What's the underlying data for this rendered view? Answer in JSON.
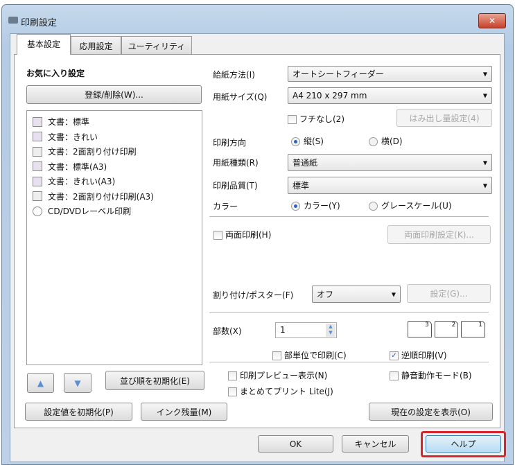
{
  "window": {
    "title": "印刷設定",
    "close_label": "✕"
  },
  "tabs": [
    {
      "label": "基本設定",
      "active": true
    },
    {
      "label": "応用設定"
    },
    {
      "label": "ユーティリティー"
    }
  ],
  "favorites": {
    "heading": "お気に入り設定",
    "register_button": "登録/削除(W)...",
    "items": [
      {
        "label": "文書：標準",
        "icon": "document-icon"
      },
      {
        "label": "文書：きれい",
        "icon": "document-fine-icon"
      },
      {
        "label": "文書：2面割り付け印刷",
        "icon": "layout-2up-icon"
      },
      {
        "label": "文書：標準(A3)",
        "icon": "document-icon"
      },
      {
        "label": "文書：きれい(A3)",
        "icon": "document-fine-icon"
      },
      {
        "label": "文書：2面割り付け印刷(A3)",
        "icon": "layout-2up-icon"
      },
      {
        "label": "CD/DVDレーベル印刷",
        "icon": "cd-icon"
      }
    ],
    "up_label": "▲",
    "down_label": "▼",
    "reset_order_button": "並び順を初期化(E)",
    "reset_settings_button": "設定値を初期化(P)",
    "ink_button": "インク残量(M)"
  },
  "settings": {
    "paper_source": {
      "label": "給紙方法(I)",
      "value": "オートシートフィーダー"
    },
    "paper_size": {
      "label": "用紙サイズ(Q)",
      "value": "A4 210 x 297 mm"
    },
    "borderless": {
      "label": "フチなし(2)",
      "checked": false
    },
    "expansion_button": "はみ出し量設定(4)",
    "orientation": {
      "label": "印刷方向",
      "portrait": "縦(S)",
      "landscape": "横(D)",
      "selected": "portrait"
    },
    "paper_type": {
      "label": "用紙種類(R)",
      "value": "普通紙"
    },
    "quality": {
      "label": "印刷品質(T)",
      "value": "標準"
    },
    "color": {
      "label": "カラー",
      "color": "カラー(Y)",
      "grayscale": "グレースケール(U)",
      "selected": "color"
    },
    "duplex": {
      "label": "両面印刷(H)",
      "checked": false
    },
    "duplex_button": "両面印刷設定(K)...",
    "layout": {
      "label": "割り付け/ポスター(F)",
      "value": "オフ"
    },
    "layout_button": "設定(G)...",
    "copies": {
      "label": "部数(X)",
      "value": "1"
    },
    "collate": {
      "label": "部単位で印刷(C)",
      "checked": false
    },
    "reverse": {
      "label": "逆順印刷(V)",
      "checked": true
    },
    "preview": {
      "label": "印刷プレビュー表示(N)",
      "checked": false
    },
    "quiet": {
      "label": "静音動作モード(B)",
      "checked": false
    },
    "lite": {
      "label": "まとめてプリント Lite(J)",
      "checked": false
    },
    "show_settings_button": "現在の設定を表示(O)"
  },
  "footer": {
    "ok": "OK",
    "cancel": "キャンセル",
    "help": "ヘルプ"
  },
  "colors": {
    "highlight": "#d8252b"
  }
}
